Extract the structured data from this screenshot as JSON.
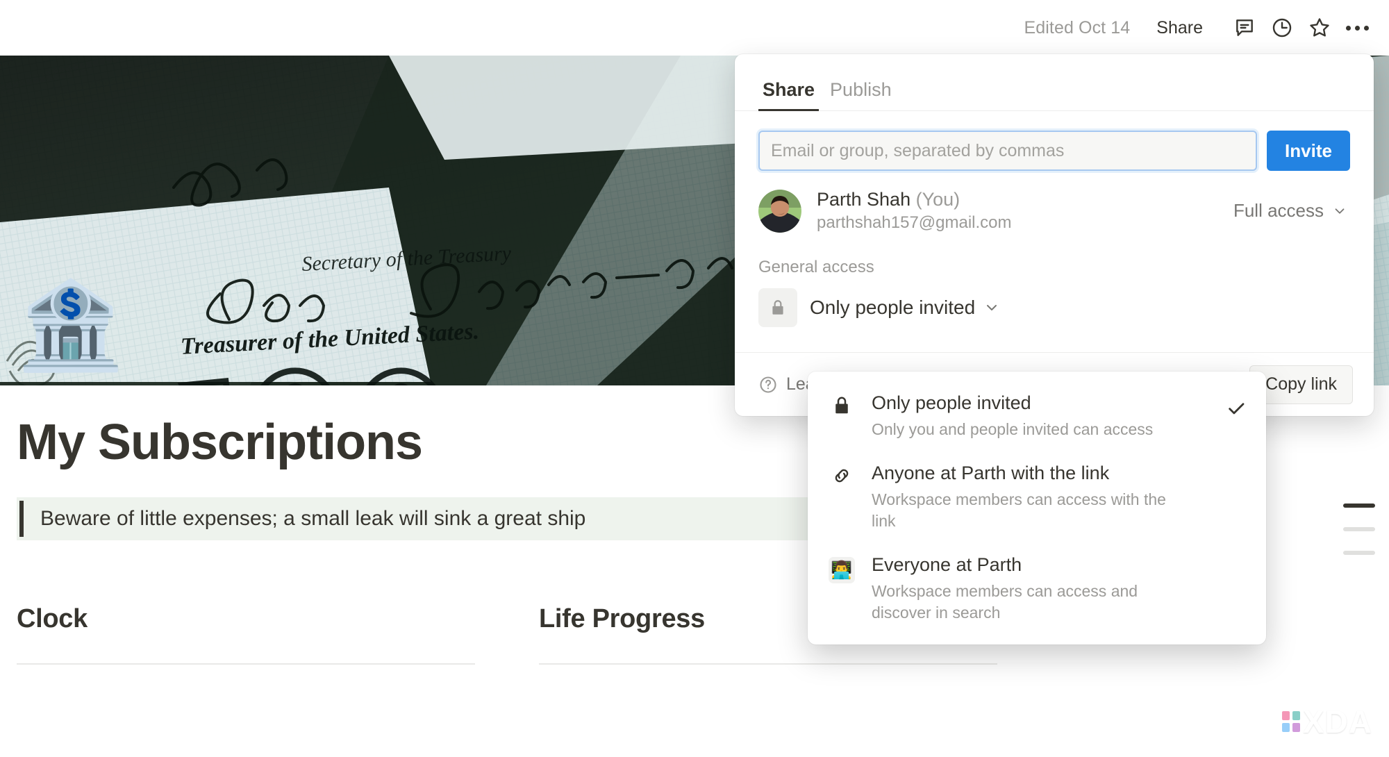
{
  "topbar": {
    "edited_label": "Edited Oct 14",
    "share_label": "Share",
    "comment_icon": "comment-icon",
    "history_icon": "clock-history-icon",
    "favorite_icon": "star-icon",
    "more_icon": "more-options-icon"
  },
  "page": {
    "emoji": "🏦",
    "title": "My Subscriptions",
    "quote": "Beware of little expenses; a small leak will sink a great ship",
    "columns": [
      {
        "heading": "Clock"
      },
      {
        "heading": "Life Progress"
      }
    ],
    "watermark": "XDA"
  },
  "share_dialog": {
    "tabs": [
      {
        "label": "Share",
        "active": true
      },
      {
        "label": "Publish",
        "active": false
      }
    ],
    "invite": {
      "placeholder": "Email or group, separated by commas",
      "value": "",
      "button_label": "Invite"
    },
    "people": [
      {
        "name": "Parth Shah",
        "you_suffix": "(You)",
        "email": "parthshah157@gmail.com",
        "access": "Full access"
      }
    ],
    "general_access": {
      "label": "General access",
      "icon": "lock-icon",
      "value": "Only people invited"
    },
    "footer": {
      "help_icon": "question-circle-icon",
      "learn_label": "Learn about sharing",
      "copy_link_label": "Copy link"
    }
  },
  "access_menu": {
    "items": [
      {
        "icon": "lock-icon",
        "title": "Only people invited",
        "description": "Only you and people invited can access",
        "checked": true
      },
      {
        "icon": "link-icon",
        "title": "Anyone at Parth with the link",
        "description": "Workspace members can access with the link",
        "checked": false
      },
      {
        "icon": "person-avatar-icon",
        "emoji": "👨‍💻",
        "title": "Everyone at Parth",
        "description": "Workspace members can access and discover in search",
        "checked": false
      }
    ]
  },
  "colors": {
    "accent": "#2383e2",
    "text": "#37352f",
    "muted": "#9b9a97",
    "callout_bg": "#eef3ed"
  }
}
